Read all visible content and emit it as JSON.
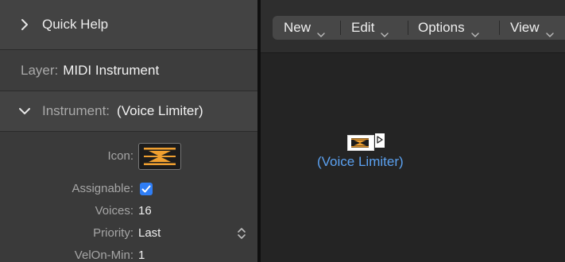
{
  "inspector": {
    "quick_help": {
      "label": "Quick Help"
    },
    "layer": {
      "label": "Layer:",
      "value": "MIDI Instrument"
    },
    "instrument": {
      "label": "Instrument:",
      "value": "(Voice Limiter)"
    },
    "params": {
      "icon": {
        "label": "Icon:",
        "icon_name": "voice-limiter-icon"
      },
      "assignable": {
        "label": "Assignable:",
        "checked": true
      },
      "voices": {
        "label": "Voices:",
        "value": "16"
      },
      "priority": {
        "label": "Priority:",
        "value": "Last"
      },
      "velon_min": {
        "label": "VelOn-Min:",
        "value": "1"
      }
    }
  },
  "toolbar": {
    "menus": [
      {
        "label": "New"
      },
      {
        "label": "Edit"
      },
      {
        "label": "Options"
      },
      {
        "label": "View"
      }
    ]
  },
  "environment": {
    "object": {
      "label": "(Voice Limiter)",
      "icon_name": "voice-limiter-icon"
    }
  },
  "colors": {
    "accent": "#2f7ef6",
    "object_label": "#5ba1f0",
    "icon_orange": "#f0a030"
  }
}
